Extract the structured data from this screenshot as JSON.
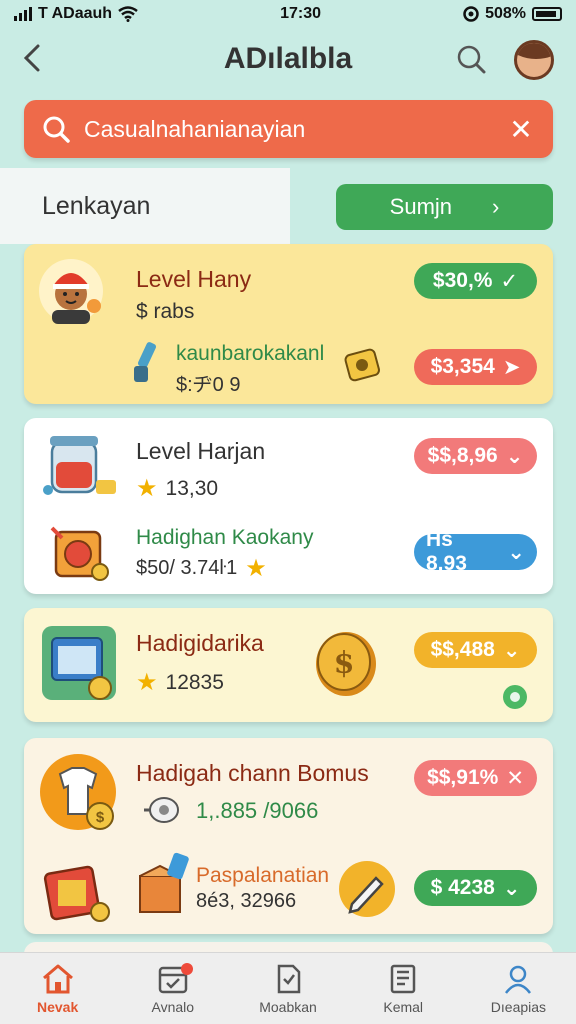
{
  "status_bar": {
    "carrier": "T ADaauh",
    "time": "17:30",
    "battery": "508%"
  },
  "header": {
    "title": "ADılalbla"
  },
  "search": {
    "query": "Casualnahanianayian"
  },
  "filter": {
    "label": "Lenkayan",
    "button_label": "Sumjn"
  },
  "cards": [
    {
      "title": "Level Hany",
      "subtitle": "$ rabs",
      "reward_label": "kaunbarokakanl",
      "reward_value": "$:ヂ0 9",
      "pill1": "$30,%",
      "pill2": "$3,354",
      "bg": "#fbe79a"
    },
    {
      "title": "Level Harjan",
      "subtitle": "13,30",
      "reward_label": "Hadighan Kaokany",
      "reward_value": "$50/ 3.74ŀ1",
      "pill1": "$$,8,96",
      "pill2": "Hs 8,93",
      "bg": "#ffffff"
    },
    {
      "title": "Hadigidarika",
      "subtitle": "12835",
      "pill1": "$$,488",
      "bg": "#fcf6d2"
    },
    {
      "title": "Hadigah сhann Bomus",
      "subtitle": "1,.885 /9066",
      "reward_label": "Paspalanatian",
      "reward_value": "8é3, 32966",
      "pill1": "$$,91%",
      "pill2": "$ 4238",
      "bg": "#fbf3e3"
    }
  ],
  "nav": [
    {
      "label": "Nevak",
      "icon": "home-icon",
      "active": true
    },
    {
      "label": "Avnalo",
      "icon": "calendar-icon",
      "active": false
    },
    {
      "label": "Moabkan",
      "icon": "document-icon",
      "active": false
    },
    {
      "label": "Kemal",
      "icon": "book-icon",
      "active": false
    },
    {
      "label": "Dıeapias",
      "icon": "profile-icon",
      "active": false
    }
  ],
  "colors": {
    "background": "#c9ece4",
    "accent_orange": "#ee6a4a",
    "green": "#3fa857",
    "red": "#ef6a5a",
    "blue": "#3d9ad9",
    "yellow": "#f2b32a",
    "title_red": "#8b2a14"
  }
}
